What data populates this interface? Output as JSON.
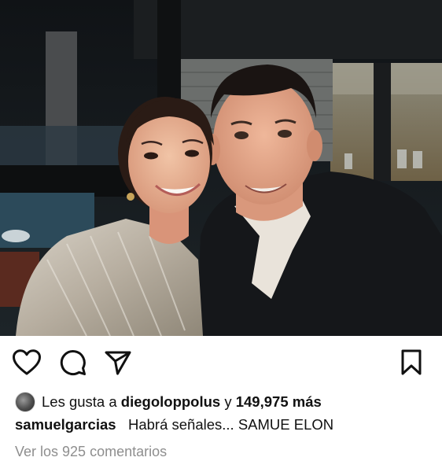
{
  "post": {
    "photo": {
      "description_icon": "couple-selfie-photo"
    },
    "actions": {
      "like_icon": "heart-icon",
      "comment_icon": "comment-icon",
      "share_icon": "send-icon",
      "save_icon": "bookmark-icon"
    },
    "likes": {
      "prefix": "Les gusta a",
      "user": "diegoloppolus",
      "connector": "y",
      "count": "149,975 más"
    },
    "caption": {
      "username": "samuelgarcias",
      "text": "Habrá señales... SAMUE ELON"
    },
    "comments_link": "Ver los 925 comentarios"
  },
  "colors": {
    "icon_stroke": "#111111",
    "muted_text": "#8e8e8e",
    "background": "#ffffff"
  }
}
